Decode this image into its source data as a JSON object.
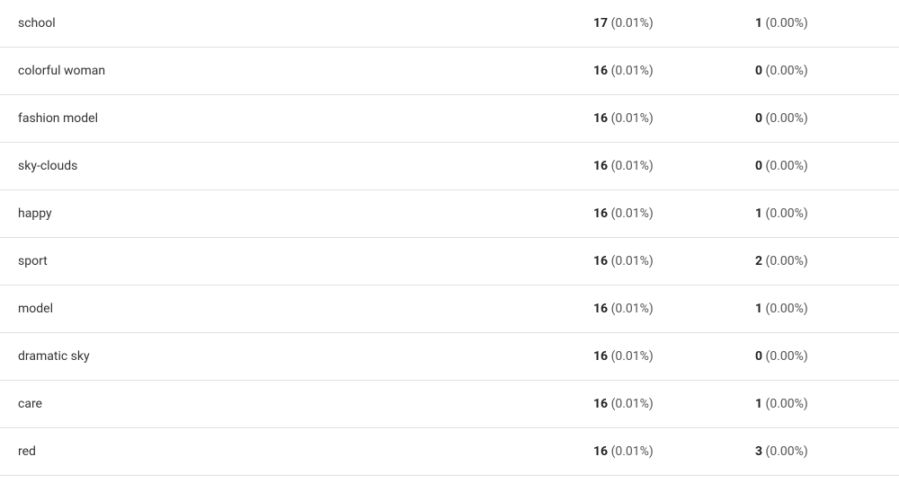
{
  "table": {
    "rows": [
      {
        "label": "school",
        "col1_num": "17",
        "col1_pct": "(0.01%)",
        "col2_num": "1",
        "col2_pct": "(0.00%)"
      },
      {
        "label": "colorful woman",
        "col1_num": "16",
        "col1_pct": "(0.01%)",
        "col2_num": "0",
        "col2_pct": "(0.00%)"
      },
      {
        "label": "fashion model",
        "col1_num": "16",
        "col1_pct": "(0.01%)",
        "col2_num": "0",
        "col2_pct": "(0.00%)"
      },
      {
        "label": "sky-clouds",
        "col1_num": "16",
        "col1_pct": "(0.01%)",
        "col2_num": "0",
        "col2_pct": "(0.00%)"
      },
      {
        "label": "happy",
        "col1_num": "16",
        "col1_pct": "(0.01%)",
        "col2_num": "1",
        "col2_pct": "(0.00%)"
      },
      {
        "label": "sport",
        "col1_num": "16",
        "col1_pct": "(0.01%)",
        "col2_num": "2",
        "col2_pct": "(0.00%)"
      },
      {
        "label": "model",
        "col1_num": "16",
        "col1_pct": "(0.01%)",
        "col2_num": "1",
        "col2_pct": "(0.00%)"
      },
      {
        "label": "dramatic sky",
        "col1_num": "16",
        "col1_pct": "(0.01%)",
        "col2_num": "0",
        "col2_pct": "(0.00%)"
      },
      {
        "label": "care",
        "col1_num": "16",
        "col1_pct": "(0.01%)",
        "col2_num": "1",
        "col2_pct": "(0.00%)"
      },
      {
        "label": "red",
        "col1_num": "16",
        "col1_pct": "(0.01%)",
        "col2_num": "3",
        "col2_pct": "(0.00%)"
      }
    ]
  }
}
